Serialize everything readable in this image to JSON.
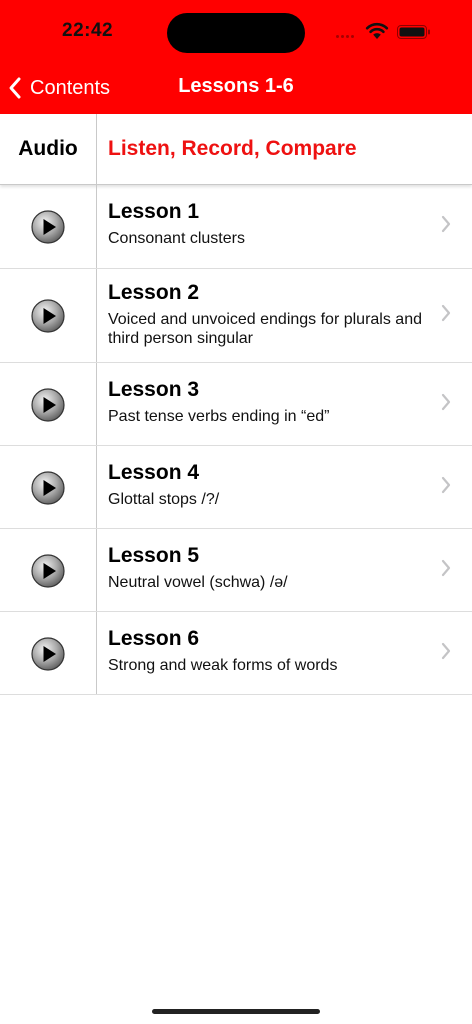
{
  "status_bar": {
    "time": "22:42"
  },
  "nav": {
    "back_label": "Contents",
    "title": "Lessons 1-6"
  },
  "table_header": {
    "audio": "Audio",
    "main": "Listen, Record, Compare"
  },
  "lessons": [
    {
      "title": "Lesson 1",
      "subtitle": "Consonant clusters"
    },
    {
      "title": "Lesson 2",
      "subtitle": "Voiced and unvoiced endings for plurals and third person singular"
    },
    {
      "title": "Lesson 3",
      "subtitle": "Past tense verbs ending in “ed”"
    },
    {
      "title": "Lesson 4",
      "subtitle": "Glottal stops /?/"
    },
    {
      "title": "Lesson 5",
      "subtitle": "Neutral vowel (schwa) /ə/"
    },
    {
      "title": "Lesson 6",
      "subtitle": "Strong and weak forms of words"
    }
  ],
  "icons": {
    "back": "chevron-left-icon",
    "play": "play-icon",
    "disclosure": "chevron-right-icon",
    "wifi": "wifi-icon",
    "battery": "battery-icon"
  },
  "colors": {
    "accent": "#ff0000",
    "header_text": "#ee1111"
  }
}
